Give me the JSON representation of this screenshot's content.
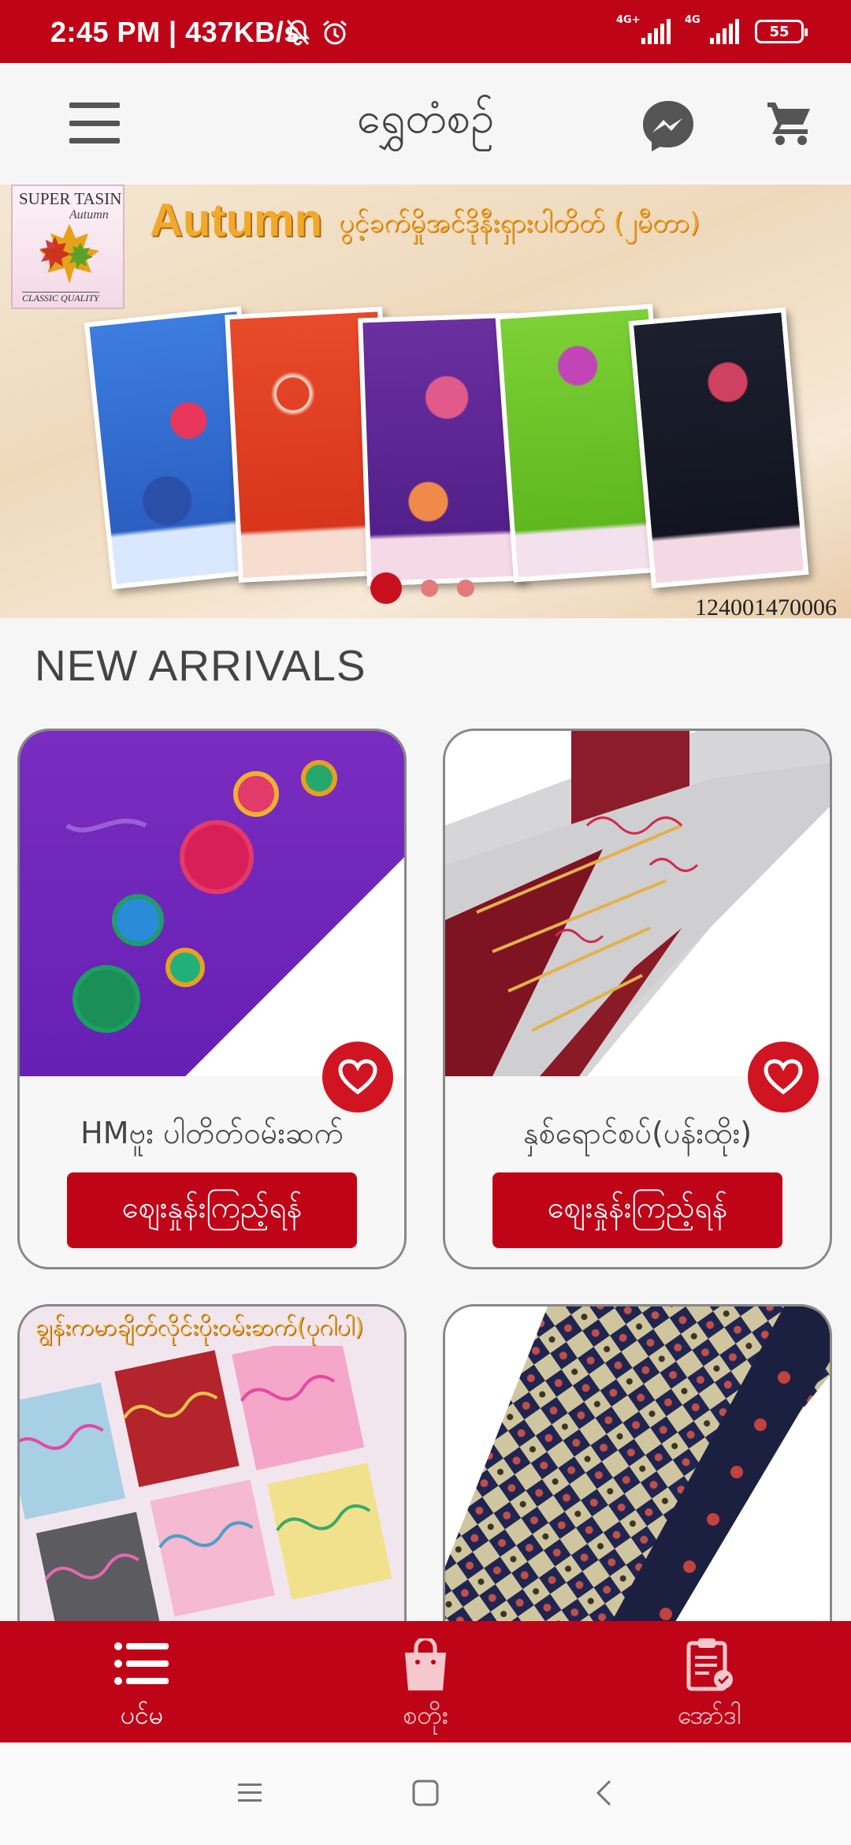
{
  "status_bar": {
    "time": "2:45 PM | 437KB/s",
    "network_1": "4G+",
    "network_2": "4G",
    "battery": "55",
    "icons": [
      "bell-off-icon",
      "alarm-icon",
      "signal-icon",
      "battery-icon"
    ]
  },
  "app_bar": {
    "title": "ရွှေတံစဥ်",
    "icons": [
      "menu-icon",
      "messenger-icon",
      "cart-icon"
    ]
  },
  "banner": {
    "logo_brand": "SUPER TASIN",
    "logo_season": "Autumn",
    "logo_tagline": "CLASSIC QUALITY",
    "headline": "Autumn",
    "subheadline": "ပွင့်ခက်မှိုအင်ဒိုနီးရှားပါတိတ် (၂မီတာ)",
    "code": "124001470006",
    "slide_count": 3,
    "active_slide": 1
  },
  "section": {
    "title": "NEW ARRIVALS"
  },
  "products": [
    {
      "name": "HMဗူး ပါတိတ်ဝမ်းဆက်",
      "button": "စျေးနှုန်းကြည့်ရန်",
      "favorite_icon": "heart-icon"
    },
    {
      "name": "နှစ်ရောင်စပ်(ပန်းထိုး)",
      "button": "စျေးနှုန်းကြည့်ရန်",
      "favorite_icon": "heart-icon"
    },
    {
      "name": "ချွန်းကမာချိတ်လိုင်းပိုးဝမ်းဆက်(ပုဂါပါ)",
      "button": "",
      "favorite_icon": "heart-icon"
    },
    {
      "name": "",
      "button": "",
      "favorite_icon": "heart-icon"
    }
  ],
  "bottom_nav": {
    "items": [
      {
        "label": "ပင်မ",
        "icon": "list-icon",
        "active": true
      },
      {
        "label": "စတိုး",
        "icon": "shopping-bag-icon",
        "active": false
      },
      {
        "label": "အော်ဒါ",
        "icon": "clipboard-check-icon",
        "active": false
      }
    ]
  },
  "colors": {
    "primary": "#c00418",
    "background": "#f6f6f6",
    "text": "#444444"
  }
}
